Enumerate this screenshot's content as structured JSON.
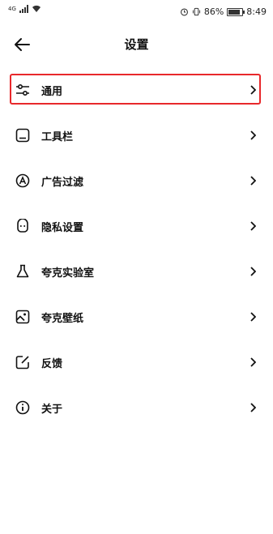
{
  "status_bar": {
    "network": "4G",
    "battery_percent": "86%",
    "battery_level": 0.86,
    "time": "8:49"
  },
  "header": {
    "title": "设置",
    "back_icon": "arrow-left-icon"
  },
  "menu": {
    "items": [
      {
        "label": "通用",
        "icon": "sliders-icon",
        "selected": true
      },
      {
        "label": "工具栏",
        "icon": "toolbar-icon",
        "selected": false
      },
      {
        "label": "广告过滤",
        "icon": "ad-block-icon",
        "selected": false
      },
      {
        "label": "隐私设置",
        "icon": "privacy-mask-icon",
        "selected": false
      },
      {
        "label": "夸克实验室",
        "icon": "flask-icon",
        "selected": false
      },
      {
        "label": "夸克壁纸",
        "icon": "wallpaper-image-icon",
        "selected": false
      },
      {
        "label": "反馈",
        "icon": "feedback-edit-icon",
        "selected": false
      },
      {
        "label": "关于",
        "icon": "info-icon",
        "selected": false
      }
    ]
  },
  "colors": {
    "highlight": "#e8282b",
    "text": "#111111",
    "background": "#ffffff"
  }
}
